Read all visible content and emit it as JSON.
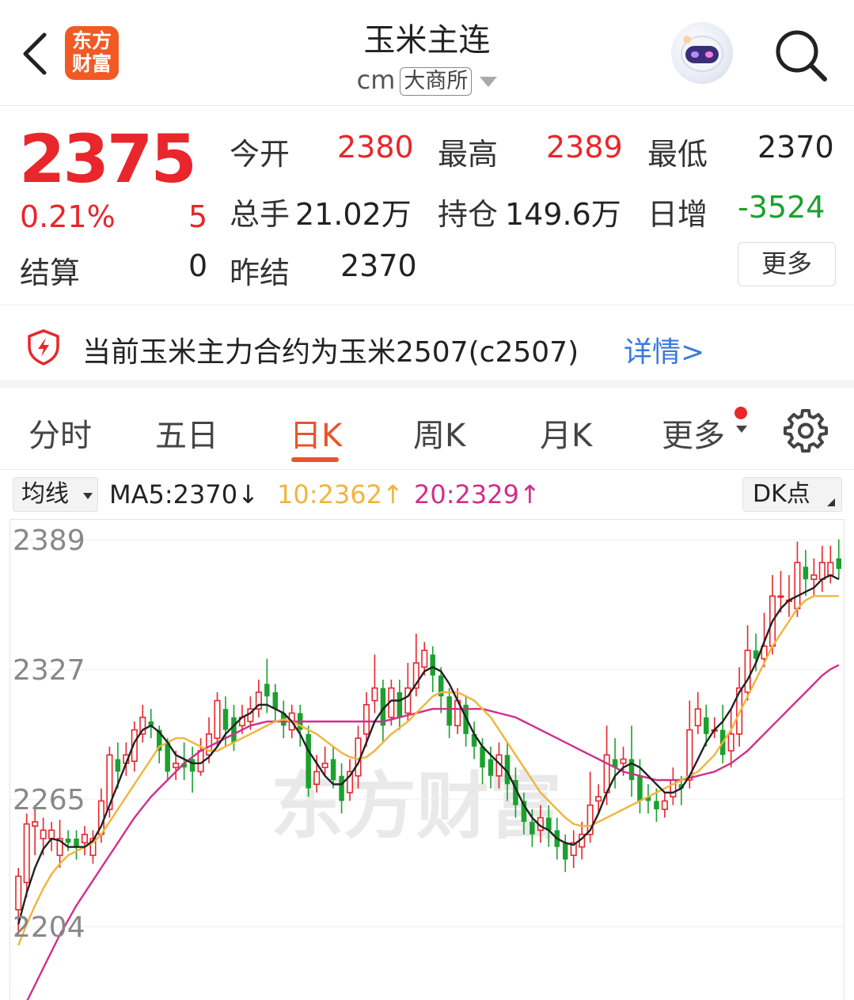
{
  "header": {
    "logo_line1": "东方",
    "logo_line2": "财富",
    "title": "玉米主连",
    "code": "cm",
    "exchange": "大商所"
  },
  "quote": {
    "price": "2375",
    "change_pct": "0.21%",
    "change": "5",
    "open_label": "今开",
    "open": "2380",
    "high_label": "最高",
    "high": "2389",
    "low_label": "最低",
    "low": "2370",
    "volume_label": "总手",
    "volume": "21.02万",
    "position_label": "持仓",
    "position": "149.6万",
    "daily_inc_label": "日增",
    "daily_inc": "-3524",
    "settle_label": "结算",
    "settle": "0",
    "prev_settle_label": "昨结",
    "prev_settle": "2370",
    "more_label": "更多"
  },
  "notice": {
    "text": "当前玉米主力合约为玉米2507(c2507)",
    "link": "详情>"
  },
  "tabs": [
    {
      "label": "分时",
      "active": false
    },
    {
      "label": "五日",
      "active": false
    },
    {
      "label": "日K",
      "active": true
    },
    {
      "label": "周K",
      "active": false
    },
    {
      "label": "月K",
      "active": false
    },
    {
      "label": "更多",
      "active": false
    }
  ],
  "ma_bar": {
    "selector": "均线",
    "ma5": "MA5:2370↓",
    "ma10": "10:2362↑",
    "ma20": "20:2329↑",
    "dk_label": "DK点"
  },
  "colors": {
    "up": "#e8262b",
    "down": "#1aa12e",
    "ma5": "#222222",
    "ma10": "#f2b43c",
    "ma20": "#d0308a",
    "accent": "#e8542b",
    "link": "#3b7ad9"
  },
  "chart_data": {
    "type": "candlestick",
    "y_ticks": [
      2389,
      2327,
      2265,
      2204
    ],
    "ylim": [
      2195,
      2395
    ],
    "watermark": "东方财富",
    "candles": [
      [
        2212,
        2228,
        2200,
        2232
      ],
      [
        2225,
        2253,
        2218,
        2258
      ],
      [
        2252,
        2254,
        2238,
        2262
      ],
      [
        2246,
        2250,
        2238,
        2256
      ],
      [
        2246,
        2250,
        2240,
        2254
      ],
      [
        2238,
        2246,
        2232,
        2255
      ],
      [
        2246,
        2244,
        2240,
        2250
      ],
      [
        2246,
        2242,
        2236,
        2250
      ],
      [
        2244,
        2248,
        2238,
        2252
      ],
      [
        2238,
        2246,
        2234,
        2250
      ],
      [
        2248,
        2264,
        2244,
        2270
      ],
      [
        2260,
        2286,
        2256,
        2290
      ],
      [
        2284,
        2278,
        2270,
        2292
      ],
      [
        2282,
        2286,
        2276,
        2292
      ],
      [
        2283,
        2298,
        2278,
        2302
      ],
      [
        2296,
        2304,
        2292,
        2310
      ],
      [
        2302,
        2300,
        2294,
        2308
      ],
      [
        2298,
        2288,
        2282,
        2300
      ],
      [
        2292,
        2278,
        2274,
        2294
      ],
      [
        2280,
        2282,
        2274,
        2288
      ],
      [
        2282,
        2280,
        2274,
        2292
      ],
      [
        2284,
        2278,
        2268,
        2290
      ],
      [
        2278,
        2288,
        2276,
        2294
      ],
      [
        2286,
        2296,
        2282,
        2304
      ],
      [
        2294,
        2312,
        2290,
        2316
      ],
      [
        2308,
        2298,
        2290,
        2314
      ],
      [
        2304,
        2292,
        2288,
        2310
      ],
      [
        2300,
        2304,
        2296,
        2310
      ],
      [
        2302,
        2308,
        2298,
        2314
      ],
      [
        2308,
        2316,
        2304,
        2322
      ],
      [
        2320,
        2314,
        2306,
        2332
      ],
      [
        2316,
        2308,
        2302,
        2320
      ],
      [
        2306,
        2300,
        2294,
        2312
      ],
      [
        2298,
        2306,
        2294,
        2310
      ],
      [
        2306,
        2298,
        2290,
        2310
      ],
      [
        2296,
        2270,
        2266,
        2300
      ],
      [
        2272,
        2278,
        2268,
        2286
      ],
      [
        2280,
        2282,
        2276,
        2290
      ],
      [
        2284,
        2274,
        2270,
        2290
      ],
      [
        2276,
        2264,
        2258,
        2282
      ],
      [
        2268,
        2278,
        2264,
        2284
      ],
      [
        2276,
        2294,
        2270,
        2300
      ],
      [
        2296,
        2310,
        2290,
        2316
      ],
      [
        2312,
        2318,
        2306,
        2334
      ],
      [
        2318,
        2300,
        2292,
        2322
      ],
      [
        2304,
        2318,
        2300,
        2322
      ],
      [
        2316,
        2304,
        2298,
        2322
      ],
      [
        2306,
        2318,
        2302,
        2330
      ],
      [
        2318,
        2330,
        2314,
        2344
      ],
      [
        2328,
        2336,
        2324,
        2340
      ],
      [
        2334,
        2324,
        2316,
        2338
      ],
      [
        2324,
        2314,
        2306,
        2328
      ],
      [
        2314,
        2300,
        2294,
        2318
      ],
      [
        2300,
        2312,
        2296,
        2318
      ],
      [
        2310,
        2296,
        2290,
        2314
      ],
      [
        2296,
        2290,
        2284,
        2302
      ],
      [
        2290,
        2280,
        2272,
        2294
      ],
      [
        2284,
        2276,
        2270,
        2290
      ],
      [
        2276,
        2286,
        2270,
        2292
      ],
      [
        2286,
        2272,
        2264,
        2292
      ],
      [
        2274,
        2262,
        2256,
        2280
      ],
      [
        2264,
        2254,
        2248,
        2268
      ],
      [
        2254,
        2248,
        2242,
        2260
      ],
      [
        2250,
        2256,
        2244,
        2262
      ],
      [
        2256,
        2250,
        2242,
        2262
      ],
      [
        2250,
        2242,
        2236,
        2256
      ],
      [
        2244,
        2236,
        2230,
        2248
      ],
      [
        2238,
        2244,
        2232,
        2250
      ],
      [
        2242,
        2248,
        2236,
        2254
      ],
      [
        2248,
        2262,
        2244,
        2278
      ],
      [
        2264,
        2266,
        2258,
        2272
      ],
      [
        2268,
        2286,
        2262,
        2300
      ],
      [
        2284,
        2280,
        2270,
        2294
      ],
      [
        2282,
        2284,
        2276,
        2290
      ],
      [
        2284,
        2274,
        2266,
        2300
      ],
      [
        2276,
        2264,
        2258,
        2284
      ],
      [
        2266,
        2264,
        2258,
        2272
      ],
      [
        2264,
        2260,
        2254,
        2270
      ],
      [
        2260,
        2264,
        2256,
        2268
      ],
      [
        2266,
        2274,
        2262,
        2280
      ],
      [
        2272,
        2270,
        2262,
        2276
      ],
      [
        2274,
        2298,
        2270,
        2312
      ],
      [
        2300,
        2308,
        2296,
        2316
      ],
      [
        2304,
        2296,
        2290,
        2310
      ],
      [
        2298,
        2298,
        2294,
        2304
      ],
      [
        2298,
        2286,
        2282,
        2310
      ],
      [
        2288,
        2296,
        2280,
        2308
      ],
      [
        2296,
        2318,
        2290,
        2328
      ],
      [
        2316,
        2336,
        2312,
        2348
      ],
      [
        2336,
        2332,
        2326,
        2344
      ],
      [
        2332,
        2338,
        2328,
        2354
      ],
      [
        2338,
        2362,
        2334,
        2372
      ],
      [
        2362,
        2362,
        2354,
        2374
      ],
      [
        2360,
        2360,
        2352,
        2372
      ],
      [
        2356,
        2378,
        2352,
        2388
      ],
      [
        2376,
        2370,
        2362,
        2384
      ],
      [
        2370,
        2372,
        2362,
        2380
      ],
      [
        2370,
        2378,
        2364,
        2386
      ],
      [
        2372,
        2378,
        2368,
        2386
      ],
      [
        2380,
        2375,
        2370,
        2389
      ]
    ],
    "ma5": [
      2205,
      2220,
      2232,
      2241,
      2246,
      2245,
      2242,
      2242,
      2242,
      2245,
      2252,
      2262,
      2272,
      2282,
      2292,
      2298,
      2300,
      2297,
      2292,
      2286,
      2284,
      2282,
      2282,
      2285,
      2290,
      2296,
      2300,
      2304,
      2306,
      2310,
      2310,
      2308,
      2306,
      2302,
      2296,
      2288,
      2282,
      2276,
      2272,
      2272,
      2276,
      2282,
      2292,
      2302,
      2308,
      2312,
      2312,
      2314,
      2320,
      2326,
      2328,
      2326,
      2320,
      2312,
      2304,
      2296,
      2290,
      2286,
      2282,
      2278,
      2270,
      2262,
      2256,
      2252,
      2250,
      2246,
      2244,
      2243,
      2246,
      2250,
      2258,
      2268,
      2276,
      2280,
      2282,
      2280,
      2276,
      2272,
      2268,
      2268,
      2270,
      2276,
      2284,
      2292,
      2298,
      2302,
      2308,
      2316,
      2322,
      2330,
      2340,
      2350,
      2356,
      2360,
      2362,
      2364,
      2366,
      2370,
      2372,
      2370
    ],
    "ma10": [
      2195,
      2205,
      2214,
      2222,
      2229,
      2234,
      2238,
      2240,
      2242,
      2244,
      2248,
      2254,
      2260,
      2266,
      2272,
      2278,
      2284,
      2290,
      2292,
      2294,
      2294,
      2292,
      2290,
      2288,
      2288,
      2290,
      2292,
      2294,
      2296,
      2298,
      2300,
      2302,
      2303,
      2302,
      2300,
      2298,
      2296,
      2293,
      2290,
      2287,
      2285,
      2284,
      2285,
      2288,
      2292,
      2296,
      2299,
      2302,
      2306,
      2310,
      2314,
      2316,
      2316,
      2316,
      2314,
      2312,
      2308,
      2304,
      2298,
      2292,
      2286,
      2280,
      2274,
      2268,
      2264,
      2260,
      2256,
      2253,
      2252,
      2252,
      2254,
      2256,
      2258,
      2260,
      2262,
      2264,
      2266,
      2268,
      2270,
      2272,
      2274,
      2276,
      2278,
      2282,
      2286,
      2292,
      2298,
      2306,
      2314,
      2322,
      2330,
      2338,
      2344,
      2350,
      2356,
      2360,
      2362,
      2362,
      2362,
      2362
    ],
    "ma20": [
      2160,
      2168,
      2176,
      2184,
      2192,
      2200,
      2207,
      2214,
      2220,
      2226,
      2232,
      2238,
      2244,
      2250,
      2256,
      2261,
      2266,
      2270,
      2274,
      2278,
      2282,
      2285,
      2288,
      2290,
      2292,
      2294,
      2296,
      2298,
      2300,
      2301,
      2302,
      2302,
      2302,
      2302,
      2302,
      2302,
      2302,
      2302,
      2302,
      2302,
      2302,
      2302,
      2302,
      2302,
      2302,
      2303,
      2304,
      2305,
      2306,
      2307,
      2308,
      2308,
      2308,
      2308,
      2308,
      2308,
      2308,
      2307,
      2306,
      2305,
      2304,
      2302,
      2300,
      2298,
      2296,
      2294,
      2292,
      2290,
      2288,
      2286,
      2284,
      2282,
      2280,
      2278,
      2277,
      2276,
      2275,
      2274,
      2274,
      2274,
      2274,
      2275,
      2276,
      2277,
      2278,
      2280,
      2282,
      2285,
      2288,
      2292,
      2296,
      2300,
      2304,
      2308,
      2312,
      2316,
      2320,
      2324,
      2327,
      2329
    ]
  }
}
